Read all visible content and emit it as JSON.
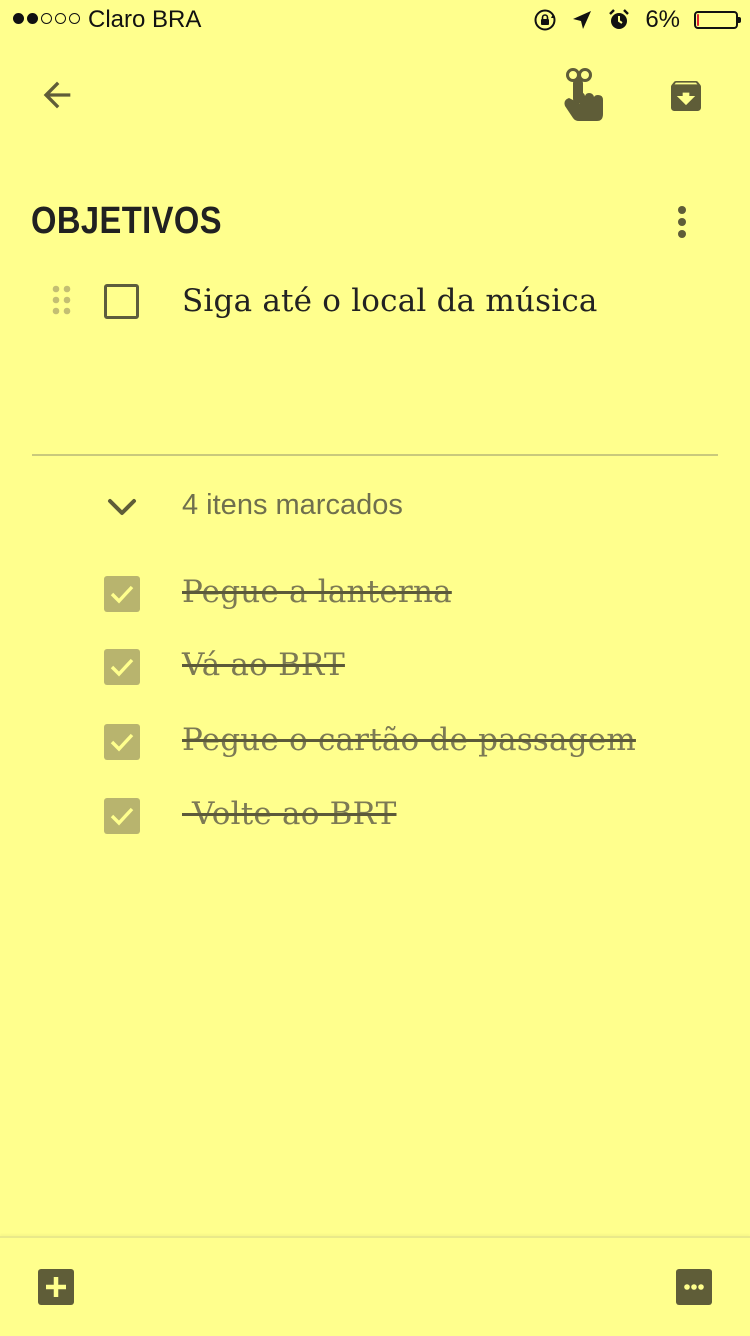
{
  "status_bar": {
    "carrier": "Claro BRA",
    "battery_percent_label": "6%",
    "battery_level": 0.06,
    "signal_bars_filled": 2,
    "signal_bars_total": 5
  },
  "toolbar": {
    "back_icon": "arrow-back-icon",
    "reminder_icon": "reminder-finger-icon",
    "archive_icon": "archive-icon"
  },
  "note": {
    "title": "OBJETIVOS",
    "unchecked_items": [
      {
        "text": "Siga até o local da música",
        "checked": false
      }
    ],
    "checked_section_label": "4 itens marcados",
    "checked_items": [
      {
        "text": "Pegue a lanterna",
        "checked": true
      },
      {
        "text": "Vá ao BRT",
        "checked": true
      },
      {
        "text": "Pegue o cartão de passagem",
        "checked": true
      },
      {
        "text": " Volte ao BRT",
        "checked": true
      }
    ]
  },
  "bottom_bar": {
    "add_icon": "add-box-icon",
    "more_icon": "more-horiz-icon"
  },
  "colors": {
    "background": "#ffff8d",
    "icon": "#5f5d38",
    "checkbox_checked": "#b8b46e",
    "battery_low": "#e0222e"
  }
}
